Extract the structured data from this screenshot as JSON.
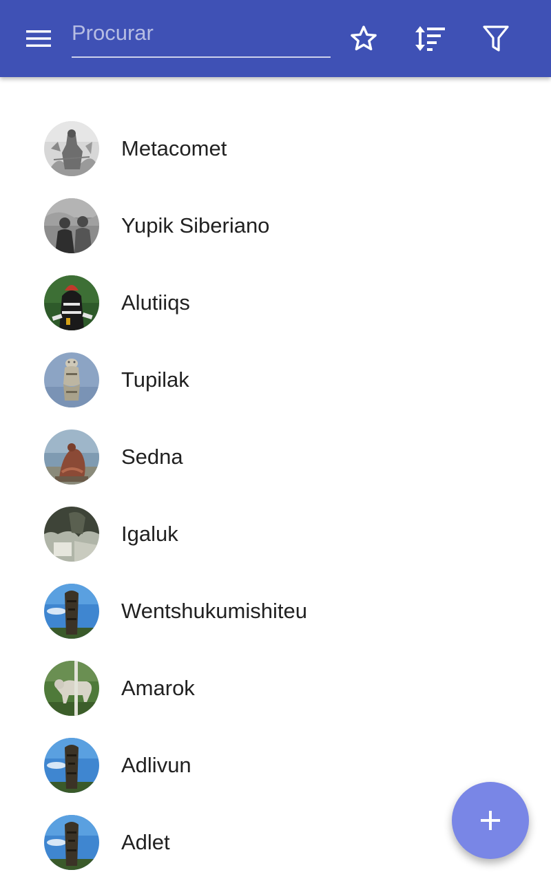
{
  "toolbar": {
    "background_color": "#3f51b5",
    "menu_icon": "hamburger-menu-icon",
    "search": {
      "placeholder": "Procurar",
      "value": ""
    },
    "actions": [
      {
        "icon": "star-outline-icon"
      },
      {
        "icon": "sort-icon"
      },
      {
        "icon": "filter-icon"
      }
    ]
  },
  "list": {
    "items": [
      {
        "label": "Metacomet"
      },
      {
        "label": "Yupik Siberiano"
      },
      {
        "label": "Alutiiqs"
      },
      {
        "label": "Tupilak"
      },
      {
        "label": "Sedna"
      },
      {
        "label": "Igaluk"
      },
      {
        "label": "Wentshukumishiteu"
      },
      {
        "label": "Amarok"
      },
      {
        "label": "Adlivun"
      },
      {
        "label": "Adlet"
      }
    ]
  },
  "fab": {
    "icon": "plus-icon",
    "color": "#7986e6"
  }
}
